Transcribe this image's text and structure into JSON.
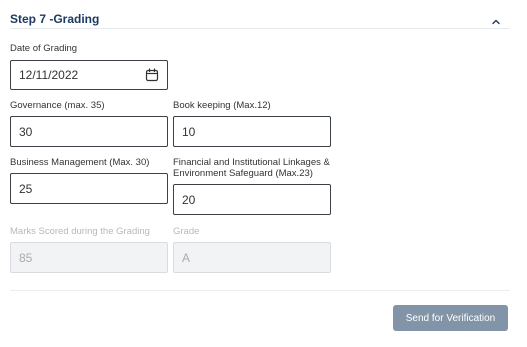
{
  "section": {
    "title": "Step 7 -Grading",
    "collapse_icon": "chevron-up-icon"
  },
  "form": {
    "date": {
      "label": "Date of Grading",
      "value": "12/11/2022",
      "icon": "calendar-icon"
    },
    "governance": {
      "label": "Governance (max. 35)",
      "value": "30"
    },
    "bookkeeping": {
      "label": "Book keeping (Max.12)",
      "value": "10"
    },
    "business": {
      "label": "Business Management (Max. 30)",
      "value": "25"
    },
    "linkages": {
      "label_line1": "Financial and Institutional Linkages &",
      "label_line2": "Environment Safeguard (Max.23)",
      "value": "20"
    },
    "marks": {
      "label": "Marks Scored during the Grading",
      "value": "85"
    },
    "grade": {
      "label": "Grade",
      "value": "A"
    }
  },
  "actions": {
    "send_label": "Send for Verification"
  },
  "colors": {
    "title": "#1c3a63",
    "button_bg": "#8294a7",
    "border": "#3b3f46",
    "disabled_bg": "#f2f3f4"
  }
}
